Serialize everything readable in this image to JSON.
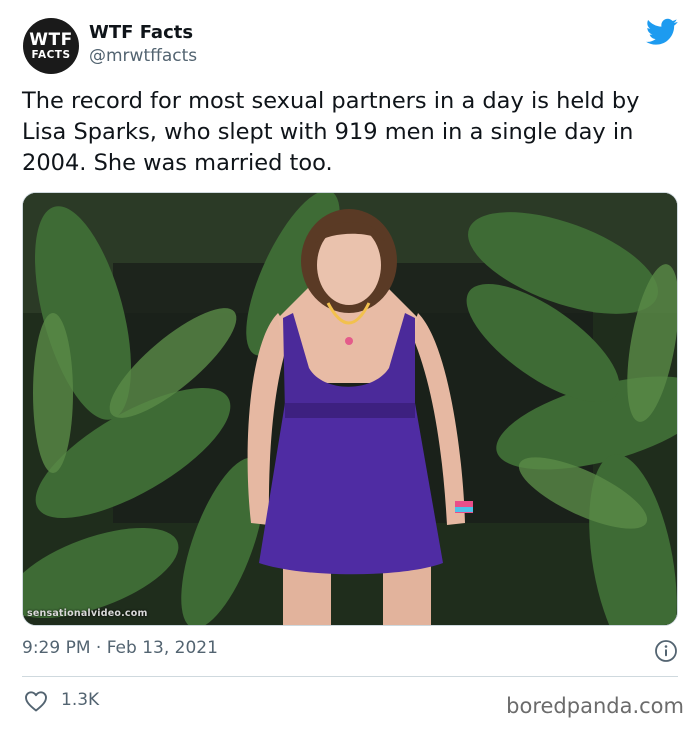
{
  "author": {
    "avatar_line1": "WTF",
    "avatar_line2": "FACTS",
    "name": "WTF Facts",
    "handle": "@mrwtffacts"
  },
  "tweet": {
    "text": "The record for most sexual partners in a day is held by Lisa Sparks, who slept with 919 men in a single day in 2004. She was married too.",
    "media_watermark": "sensationalvideo.com",
    "timestamp": "9:29 PM · Feb 13, 2021",
    "likes": "1.3K"
  },
  "footer": {
    "credit": "boredpanda.com"
  },
  "colors": {
    "twitter_blue": "#1d9bf0",
    "dress_purple": "#4b2a9a",
    "muted_text": "#536471"
  },
  "icons": [
    "twitter-bird-icon",
    "info-icon",
    "heart-icon"
  ]
}
